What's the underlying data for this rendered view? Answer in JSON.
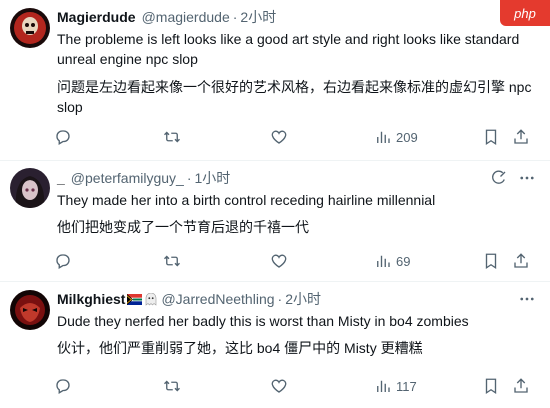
{
  "watermark": "php",
  "tweets": [
    {
      "display_name": "Magierdude",
      "handle": "@magierdude",
      "separator": "·",
      "time": "2小时",
      "text_en": "The probleme is left looks like a good art style and right looks like standard unreal engine npc slop",
      "text_cn": "问题是左边看起来像一个很好的艺术风格，右边看起来像标准的虚幻引擎 npc slop",
      "views": "209",
      "avatar_icon": "red-skull-avatar"
    },
    {
      "display_name": "_",
      "handle": "@peterfamilyguy_",
      "separator": "·",
      "time": "1小时",
      "text_en": "They made her into a birth control receding hairline millennial",
      "text_cn": "他们把她变成了一个节育后退的千禧一代",
      "views": "69",
      "avatar_icon": "dark-hair-girl-avatar"
    },
    {
      "display_name": "Milkghiest",
      "handle": "@JarredNeethling",
      "separator": "·",
      "time": "2小时",
      "text_en": "Dude they nerfed her badly this is worst than Misty in bo4 zombies",
      "text_cn": "伙计，他们严重削弱了她，这比 bo4 僵尸中的 Misty 更糟糕",
      "views": "117",
      "avatar_icon": "red-mask-avatar"
    }
  ],
  "colors": {
    "text": "#0f1419",
    "muted": "#536471",
    "divider": "#eff3f4",
    "watermark_bg": "#e43a2e"
  }
}
